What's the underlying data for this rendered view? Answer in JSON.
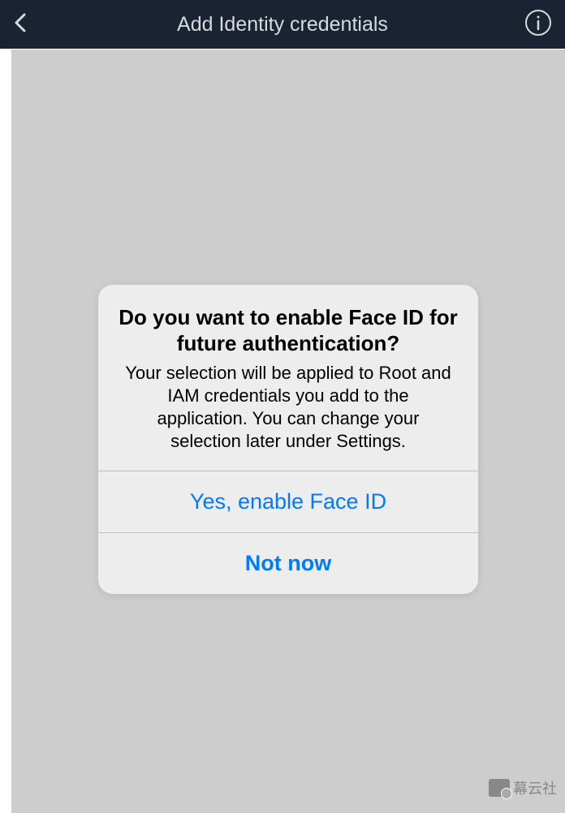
{
  "header": {
    "title": "Add Identity credentials"
  },
  "alert": {
    "title": "Do you want to enable Face ID for future authentication?",
    "message": "Your selection will be applied to Root and IAM credentials you add to the application. You can change your selection later under Settings.",
    "primary_button": "Yes, enable Face ID",
    "secondary_button": "Not now"
  },
  "watermark": {
    "text": "幕云社"
  }
}
